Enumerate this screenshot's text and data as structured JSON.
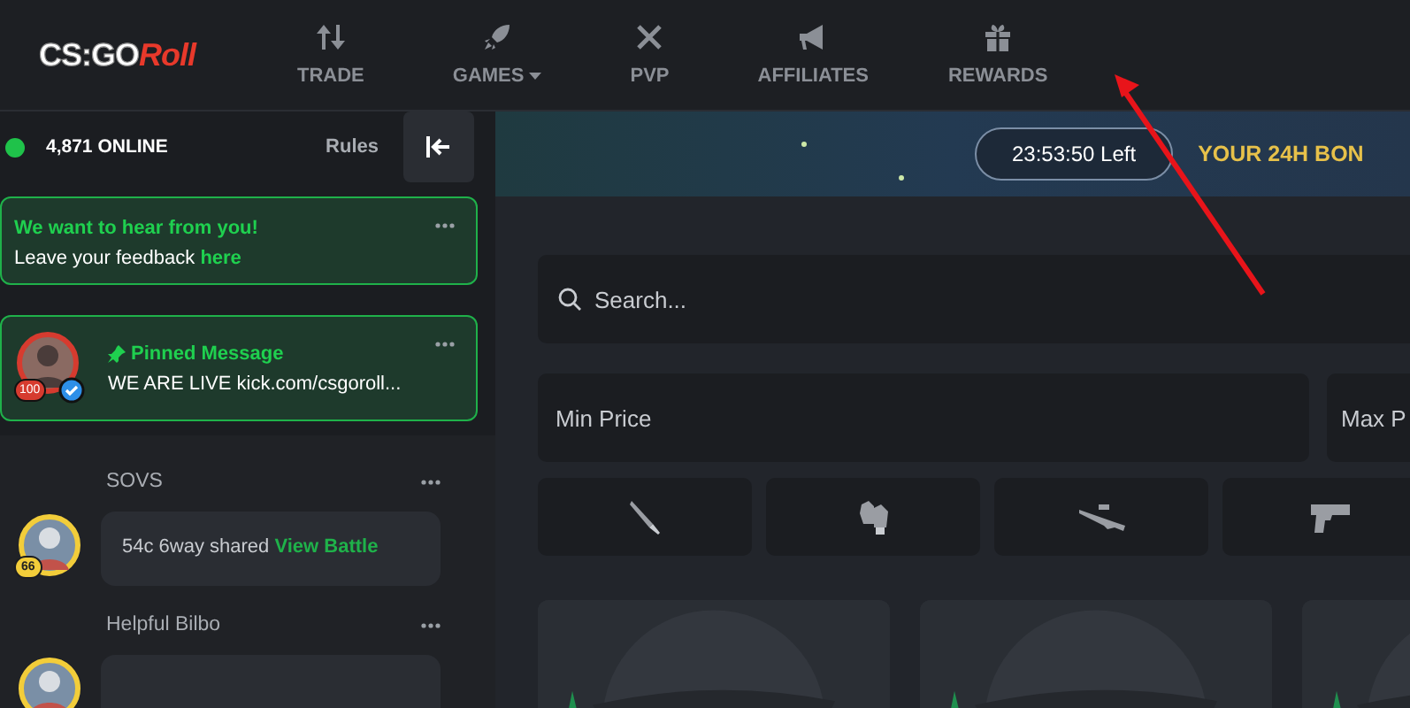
{
  "logo": {
    "text": "CS:GO",
    "accent": "Roll"
  },
  "nav": [
    {
      "label": "TRADE",
      "dropdown": false
    },
    {
      "label": "GAMES",
      "dropdown": true
    },
    {
      "label": "PVP",
      "dropdown": false
    },
    {
      "label": "AFFILIATES",
      "dropdown": false
    },
    {
      "label": "REWARDS",
      "dropdown": false
    }
  ],
  "sidebar": {
    "online": "4,871 ONLINE",
    "rules": "Rules",
    "feedback": {
      "title": "We want to hear from you!",
      "text": "Leave your feedback ",
      "link": "here"
    },
    "pinned": {
      "level": "100",
      "color": "#d63b2f",
      "verified": true,
      "title": "Pinned Message",
      "text": "WE ARE LIVE kick.com/csgoroll..."
    },
    "messages": [
      {
        "name": "SOVS",
        "level": "66",
        "color": "#f2cd3a",
        "text": "54c 6way shared ",
        "link": "View Battle"
      },
      {
        "name": "Helpful Bilbo"
      }
    ]
  },
  "banner": {
    "timer": "23:53:50 Left",
    "headline": "YOUR 24H BON"
  },
  "search": {
    "placeholder": "Search..."
  },
  "price": {
    "min_placeholder": "Min Price",
    "max_placeholder": "Max P"
  }
}
